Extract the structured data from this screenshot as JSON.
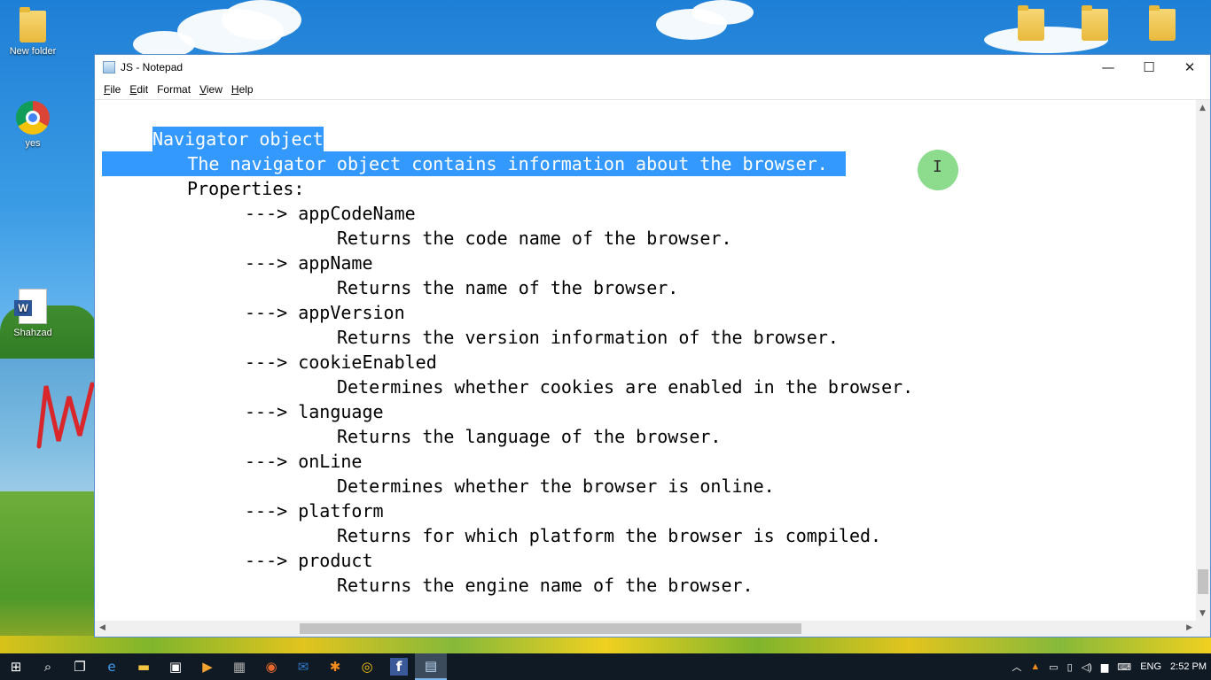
{
  "desktop": {
    "icons": [
      {
        "label": "New folder"
      },
      {
        "label": "yes"
      },
      {
        "label": "Shahzad"
      }
    ]
  },
  "window": {
    "title": "JS - Notepad",
    "controls": {
      "minimize": "—",
      "maximize": "☐",
      "close": "✕"
    },
    "menu": [
      {
        "key": "F",
        "rest": "ile"
      },
      {
        "key": "E",
        "rest": "dit"
      },
      {
        "key": "F",
        "rest": "ormat",
        "underline_first": false,
        "full": "Format"
      },
      {
        "key": "V",
        "rest": "iew"
      },
      {
        "key": "H",
        "rest": "elp"
      }
    ]
  },
  "editor": {
    "lines": [
      "Navigator object",
      "        The navigator object contains information about the browser.",
      "Properties:",
      "---> appCodeName",
      "Returns the code name of the browser.",
      "---> appName",
      "Returns the name of the browser.",
      "---> appVersion",
      "Returns the version information of the browser.",
      "---> cookieEnabled",
      "Determines whether cookies are enabled in the browser.",
      "---> language",
      "Returns the language of the browser.",
      "---> onLine",
      "Determines whether the browser is online.",
      "---> platform",
      "Returns for which platform the browser is compiled.",
      "---> product",
      "Returns the engine name of the browser."
    ]
  },
  "taskbar": {
    "icons": [
      "windows-start",
      "search",
      "task-view",
      "edge",
      "file-explorer",
      "store",
      "media-player",
      "app-grid",
      "firefox",
      "outlook",
      "paint",
      "chrome",
      "facebook",
      "notepad"
    ],
    "tray": {
      "language": "ENG",
      "time": "2:52 PM"
    }
  }
}
